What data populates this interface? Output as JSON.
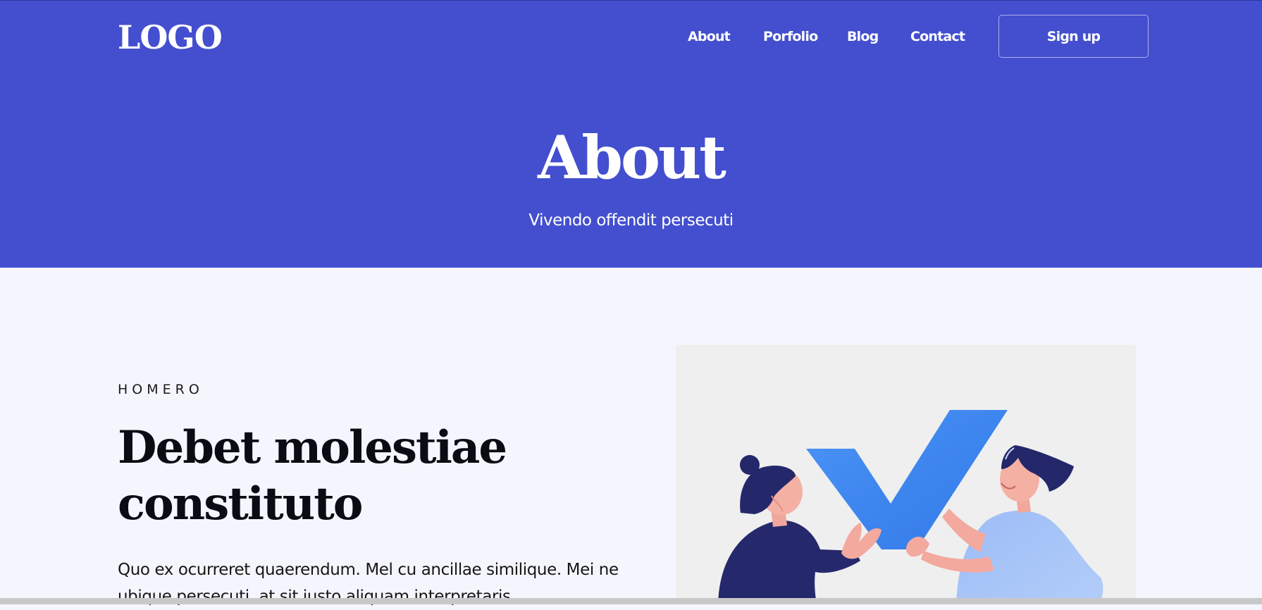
{
  "header": {
    "logo": "LOGO",
    "nav": {
      "about": "About",
      "porfolio": "Porfolio",
      "blog": "Blog",
      "contact": "Contact"
    },
    "signup_label": "Sign up"
  },
  "hero": {
    "title": "About",
    "subtitle": "Vivendo offendit persecuti"
  },
  "section": {
    "eyebrow": "HOMERO",
    "title": "Debet molestiae constituto",
    "body": "Quo ex ocurreret quaerendum. Mel cu ancillae similique. Mei ne ubique persecuti, at sit iusto aliquam interpretaris."
  },
  "colors": {
    "hero_bg": "#434fcf",
    "page_bg": "#f5f6fd",
    "illustration_bg": "#efefef",
    "check_blue": "#3f8cf2",
    "navy": "#25296b",
    "light_blue": "#a3c3f7",
    "skin": "#f2a79c"
  },
  "icons": {
    "illustration": "checkmark-collaboration-illustration"
  }
}
